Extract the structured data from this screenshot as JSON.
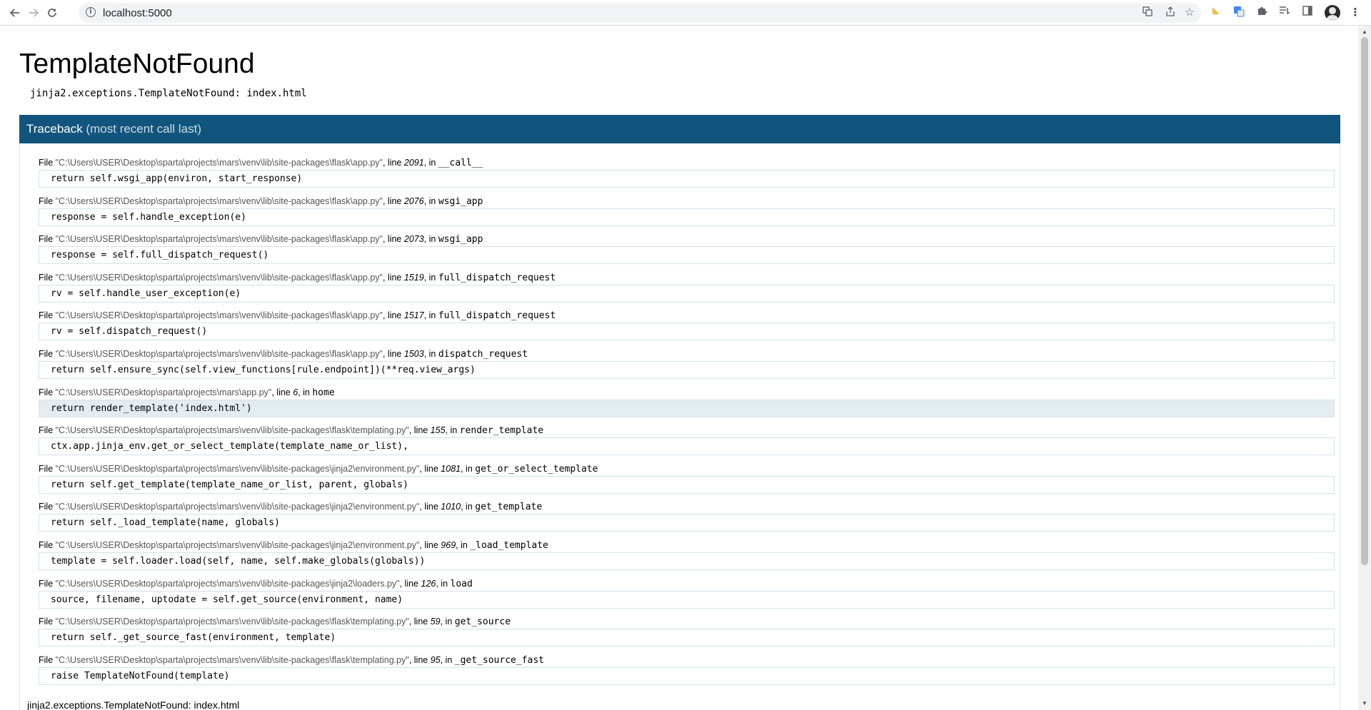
{
  "browser": {
    "url": "localhost:5000",
    "icons": {
      "back": "back-arrow-icon",
      "forward": "forward-arrow-icon",
      "reload": "reload-icon",
      "site_info": "info-icon",
      "translate": "translate-icon",
      "share": "share-icon",
      "bookmark": "star-icon",
      "extensions": [
        "extension-ruler-icon",
        "google-translate-icon",
        "puzzle-icon",
        "reading-list-icon",
        "side-panel-icon"
      ],
      "profile": "avatar",
      "menu": "kebab-menu-icon"
    }
  },
  "page": {
    "title": "TemplateNotFound",
    "error_line": "jinja2.exceptions.TemplateNotFound: index.html",
    "traceback_header": "Traceback",
    "traceback_sub": "(most recent call last)",
    "final_error": "jinja2.exceptions.TemplateNotFound: index.html",
    "frames": [
      {
        "file": "\"C:\\Users\\USER\\Desktop\\sparta\\projects\\mars\\venv\\lib\\site-packages\\flask\\app.py\"",
        "line": "2091",
        "func": "__call__",
        "code": "return self.wsgi_app(environ, start_response)"
      },
      {
        "file": "\"C:\\Users\\USER\\Desktop\\sparta\\projects\\mars\\venv\\lib\\site-packages\\flask\\app.py\"",
        "line": "2076",
        "func": "wsgi_app",
        "code": "response = self.handle_exception(e)"
      },
      {
        "file": "\"C:\\Users\\USER\\Desktop\\sparta\\projects\\mars\\venv\\lib\\site-packages\\flask\\app.py\"",
        "line": "2073",
        "func": "wsgi_app",
        "code": "response = self.full_dispatch_request()"
      },
      {
        "file": "\"C:\\Users\\USER\\Desktop\\sparta\\projects\\mars\\venv\\lib\\site-packages\\flask\\app.py\"",
        "line": "1519",
        "func": "full_dispatch_request",
        "code": "rv = self.handle_user_exception(e)"
      },
      {
        "file": "\"C:\\Users\\USER\\Desktop\\sparta\\projects\\mars\\venv\\lib\\site-packages\\flask\\app.py\"",
        "line": "1517",
        "func": "full_dispatch_request",
        "code": "rv = self.dispatch_request()"
      },
      {
        "file": "\"C:\\Users\\USER\\Desktop\\sparta\\projects\\mars\\venv\\lib\\site-packages\\flask\\app.py\"",
        "line": "1503",
        "func": "dispatch_request",
        "code": "return self.ensure_sync(self.view_functions[rule.endpoint])(**req.view_args)"
      },
      {
        "file": "\"C:\\Users\\USER\\Desktop\\sparta\\projects\\mars\\app.py\"",
        "line": "6",
        "func": "home",
        "code": "return render_template('index.html')",
        "current": true
      },
      {
        "file": "\"C:\\Users\\USER\\Desktop\\sparta\\projects\\mars\\venv\\lib\\site-packages\\flask\\templating.py\"",
        "line": "155",
        "func": "render_template",
        "code": "ctx.app.jinja_env.get_or_select_template(template_name_or_list),"
      },
      {
        "file": "\"C:\\Users\\USER\\Desktop\\sparta\\projects\\mars\\venv\\lib\\site-packages\\jinja2\\environment.py\"",
        "line": "1081",
        "func": "get_or_select_template",
        "code": "return self.get_template(template_name_or_list, parent, globals)"
      },
      {
        "file": "\"C:\\Users\\USER\\Desktop\\sparta\\projects\\mars\\venv\\lib\\site-packages\\jinja2\\environment.py\"",
        "line": "1010",
        "func": "get_template",
        "code": "return self._load_template(name, globals)"
      },
      {
        "file": "\"C:\\Users\\USER\\Desktop\\sparta\\projects\\mars\\venv\\lib\\site-packages\\jinja2\\environment.py\"",
        "line": "969",
        "func": "_load_template",
        "code": "template = self.loader.load(self, name, self.make_globals(globals))"
      },
      {
        "file": "\"C:\\Users\\USER\\Desktop\\sparta\\projects\\mars\\venv\\lib\\site-packages\\jinja2\\loaders.py\"",
        "line": "126",
        "func": "load",
        "code": "source, filename, uptodate = self.get_source(environment, name)"
      },
      {
        "file": "\"C:\\Users\\USER\\Desktop\\sparta\\projects\\mars\\venv\\lib\\site-packages\\flask\\templating.py\"",
        "line": "59",
        "func": "get_source",
        "code": "return self._get_source_fast(environment, template)"
      },
      {
        "file": "\"C:\\Users\\USER\\Desktop\\sparta\\projects\\mars\\venv\\lib\\site-packages\\flask\\templating.py\"",
        "line": "95",
        "func": "_get_source_fast",
        "code": "raise TemplateNotFound(template)"
      }
    ],
    "labels": {
      "file_prefix": "File ",
      "line_prefix": ", line ",
      "in_prefix": ", in "
    }
  },
  "colors": {
    "traceback_header_bg": "#11557c",
    "code_border": "#cfe3ec",
    "current_frame_bg": "#e3ecf1"
  }
}
